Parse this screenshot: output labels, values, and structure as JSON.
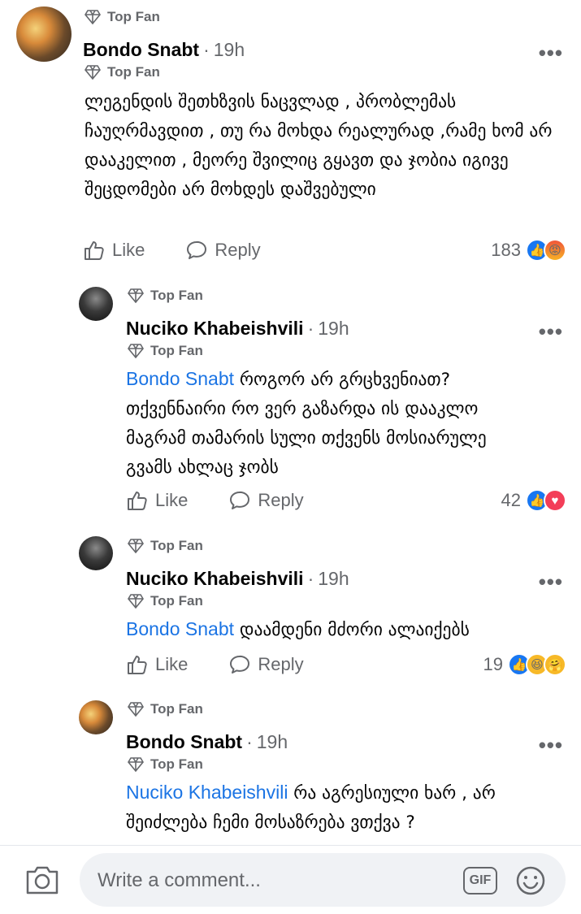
{
  "comments": [
    {
      "badge": "Top Fan",
      "name": "Bondo Snabt",
      "time": "19h",
      "text": "ლეგენდის შეთხზვის ნაცვლად , პრობლემას ჩაუღრმავდით , თუ რა მოხდა რეალურად ,რამე ხომ არ დააკელით , მეორე შვილიც გყავთ და ჯობია იგივე შეცდომები არ მოხდეს დაშვებული",
      "like": "Like",
      "reply": "Reply",
      "reactions": "183",
      "more": "•••"
    },
    {
      "badge": "Top Fan",
      "name": "Nuciko Khabeishvili",
      "time": "19h",
      "mention": "Bondo Snabt",
      "text": "როგორ არ გრცხვენიათ? თქვენნაირი რო ვერ გაზარდა ის დააკლო მაგრამ თამარის სული თქვენს მოსიარულე გვამს ახლაც ჯობს",
      "like": "Like",
      "reply": "Reply",
      "reactions": "42",
      "more": "•••"
    },
    {
      "badge": "Top Fan",
      "name": "Nuciko Khabeishvili",
      "time": "19h",
      "mention": "Bondo Snabt",
      "text": "დაამდენი მძორი ალაიქებს",
      "like": "Like",
      "reply": "Reply",
      "reactions": "19",
      "more": "•••"
    },
    {
      "badge": "Top Fan",
      "name": "Bondo Snabt",
      "time": "19h",
      "mention": "Nuciko Khabeishvili",
      "text": "რა აგრესიული ხარ , არ შეიძლება ჩემი მოსაზრება ვთქვა ?",
      "more": "•••"
    }
  ],
  "composer": {
    "placeholder": "Write a comment...",
    "gif_label": "GIF"
  },
  "icons": {
    "badge": "diamond-icon",
    "like": "thumbs-up-icon",
    "reply": "speech-bubble-icon",
    "camera": "camera-icon",
    "emoji": "smiley-icon"
  },
  "colors": {
    "mention": "#1b74e4",
    "like_reaction": "#1877f2",
    "secondary_text": "#65676b"
  }
}
